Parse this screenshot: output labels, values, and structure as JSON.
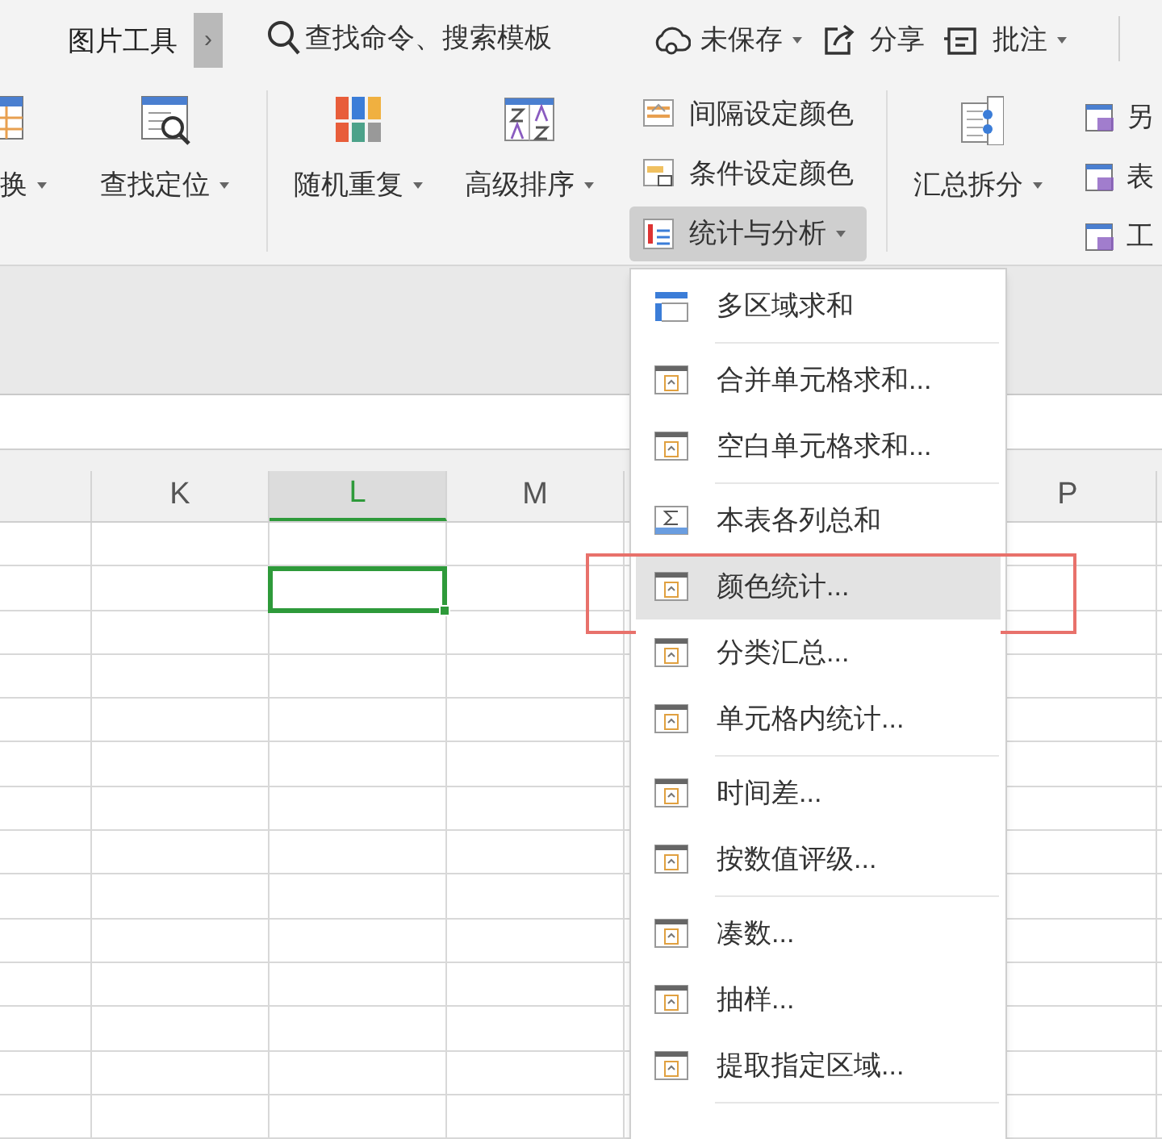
{
  "top_bar": {
    "tab_label": "图片工具",
    "more_glyph": "›",
    "search_placeholder": "查找命令、搜索模板",
    "actions": [
      {
        "label": "未保存",
        "dropdown": true
      },
      {
        "label": "分享",
        "dropdown": false
      },
      {
        "label": "批注",
        "dropdown": true
      }
    ]
  },
  "ribbon": {
    "large_buttons_left": [
      {
        "label": "换",
        "dropdown": true
      },
      {
        "label": "查找定位",
        "dropdown": true
      },
      {
        "label": "随机重复",
        "dropdown": true
      },
      {
        "label": "高级排序",
        "dropdown": true
      }
    ],
    "small_buttons": [
      {
        "label": "间隔设定颜色",
        "dropdown": false,
        "selected": false
      },
      {
        "label": "条件设定颜色",
        "dropdown": false,
        "selected": false
      },
      {
        "label": "统计与分析",
        "dropdown": true,
        "selected": true
      }
    ],
    "large_buttons_right": [
      {
        "label": "汇总拆分",
        "dropdown": true
      }
    ],
    "cut_buttons": [
      {
        "label": "另"
      },
      {
        "label": "表"
      },
      {
        "label": "工"
      }
    ]
  },
  "sheet": {
    "columns": [
      {
        "label": "K",
        "selected": false
      },
      {
        "label": "L",
        "selected": true
      },
      {
        "label": "M",
        "selected": false
      },
      {
        "label": "P",
        "selected": false
      }
    ]
  },
  "menu": {
    "items": [
      {
        "kind": "item",
        "label": "多区域求和",
        "selected": false,
        "annotated": false
      },
      {
        "kind": "separator"
      },
      {
        "kind": "item",
        "label": "合并单元格求和...",
        "selected": false,
        "annotated": false
      },
      {
        "kind": "item",
        "label": "空白单元格求和...",
        "selected": false,
        "annotated": false
      },
      {
        "kind": "separator"
      },
      {
        "kind": "item",
        "label": "本表各列总和",
        "selected": false,
        "annotated": false
      },
      {
        "kind": "item",
        "label": "颜色统计...",
        "selected": true,
        "annotated": true
      },
      {
        "kind": "item",
        "label": "分类汇总...",
        "selected": false,
        "annotated": false
      },
      {
        "kind": "item",
        "label": "单元格内统计...",
        "selected": false,
        "annotated": false
      },
      {
        "kind": "separator"
      },
      {
        "kind": "item",
        "label": "时间差...",
        "selected": false,
        "annotated": false
      },
      {
        "kind": "item",
        "label": "按数值评级...",
        "selected": false,
        "annotated": false
      },
      {
        "kind": "separator"
      },
      {
        "kind": "item",
        "label": "凑数...",
        "selected": false,
        "annotated": false
      },
      {
        "kind": "item",
        "label": "抽样...",
        "selected": false,
        "annotated": false
      },
      {
        "kind": "item",
        "label": "提取指定区域...",
        "selected": false,
        "annotated": false
      },
      {
        "kind": "separator"
      }
    ]
  }
}
